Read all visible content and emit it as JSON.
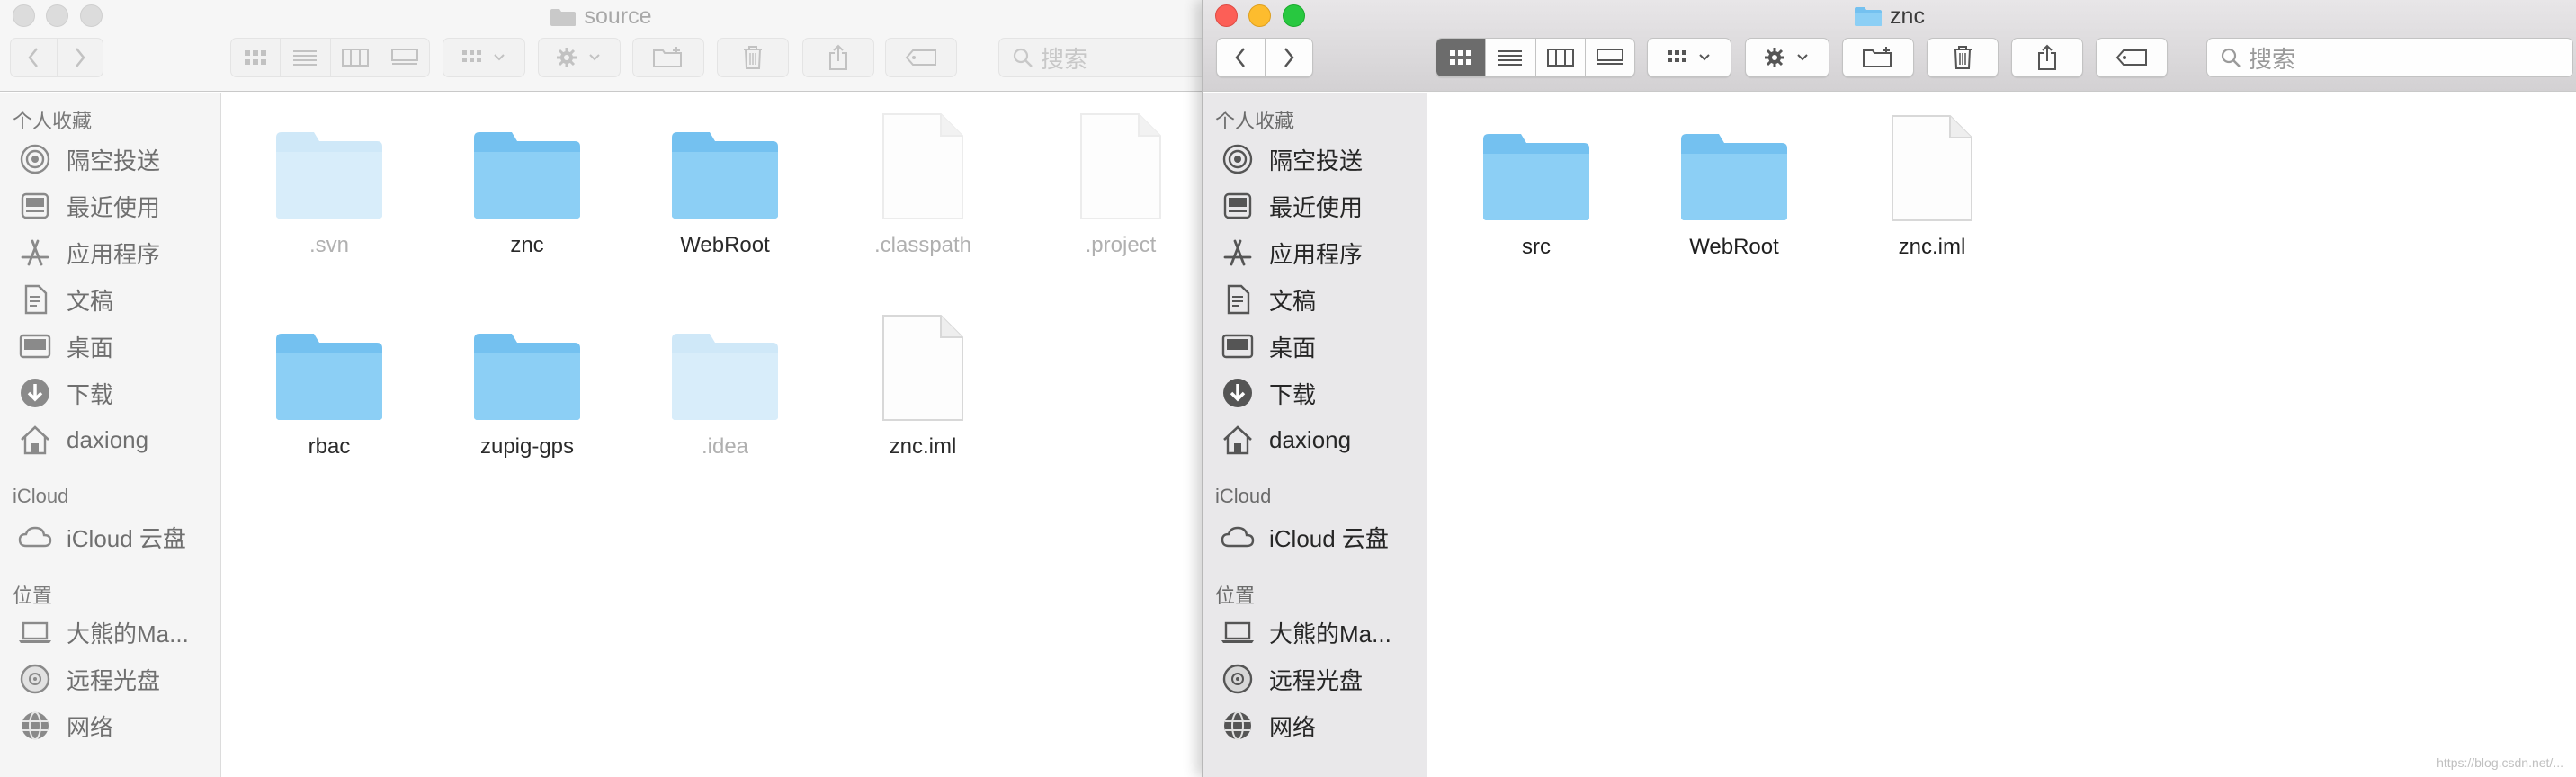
{
  "left_window": {
    "title": "source",
    "search_placeholder": "搜索",
    "sidebar": {
      "favorites_header": "个人收藏",
      "favorites": [
        {
          "label": "隔空投送",
          "icon": "airdrop-icon"
        },
        {
          "label": "最近使用",
          "icon": "recents-icon"
        },
        {
          "label": "应用程序",
          "icon": "applications-icon"
        },
        {
          "label": "文稿",
          "icon": "documents-icon"
        },
        {
          "label": "桌面",
          "icon": "desktop-icon"
        },
        {
          "label": "下载",
          "icon": "downloads-icon"
        },
        {
          "label": "daxiong",
          "icon": "home-icon"
        }
      ],
      "icloud_header": "iCloud",
      "icloud": [
        {
          "label": "iCloud 云盘",
          "icon": "cloud-icon"
        }
      ],
      "locations_header": "位置",
      "locations": [
        {
          "label": "大熊的Ma...",
          "icon": "laptop-icon"
        },
        {
          "label": "远程光盘",
          "icon": "disc-icon"
        },
        {
          "label": "网络",
          "icon": "network-icon"
        }
      ]
    },
    "files": [
      {
        "name": ".svn",
        "kind": "folder",
        "dim": true
      },
      {
        "name": "znc",
        "kind": "folder",
        "dim": false
      },
      {
        "name": "WebRoot",
        "kind": "folder",
        "dim": false
      },
      {
        "name": ".classpath",
        "kind": "document",
        "dim": true
      },
      {
        "name": ".project",
        "kind": "document",
        "dim": true
      },
      {
        "name": "rbac",
        "kind": "folder",
        "dim": false
      },
      {
        "name": "zupig-gps",
        "kind": "folder",
        "dim": false
      },
      {
        "name": ".idea",
        "kind": "folder",
        "dim": true
      },
      {
        "name": "znc.iml",
        "kind": "document",
        "dim": false
      }
    ]
  },
  "right_window": {
    "title": "znc",
    "search_placeholder": "搜索",
    "sidebar": {
      "favorites_header": "个人收藏",
      "favorites": [
        {
          "label": "隔空投送",
          "icon": "airdrop-icon"
        },
        {
          "label": "最近使用",
          "icon": "recents-icon"
        },
        {
          "label": "应用程序",
          "icon": "applications-icon"
        },
        {
          "label": "文稿",
          "icon": "documents-icon"
        },
        {
          "label": "桌面",
          "icon": "desktop-icon"
        },
        {
          "label": "下载",
          "icon": "downloads-icon"
        },
        {
          "label": "daxiong",
          "icon": "home-icon"
        }
      ],
      "icloud_header": "iCloud",
      "icloud": [
        {
          "label": "iCloud 云盘",
          "icon": "cloud-icon"
        }
      ],
      "locations_header": "位置",
      "locations": [
        {
          "label": "大熊的Ma...",
          "icon": "laptop-icon"
        },
        {
          "label": "远程光盘",
          "icon": "disc-icon"
        },
        {
          "label": "网络",
          "icon": "network-icon"
        }
      ]
    },
    "files": [
      {
        "name": "src",
        "kind": "folder",
        "dim": false
      },
      {
        "name": "WebRoot",
        "kind": "folder",
        "dim": false
      },
      {
        "name": "znc.iml",
        "kind": "document",
        "dim": false
      }
    ]
  },
  "watermark": "https://blog.csdn.net/...",
  "colors": {
    "folder": "#8ccff5",
    "folder_dim": "#cfe8f8",
    "close": "#fc5f57",
    "minimize": "#fdbc2e",
    "zoom": "#28c840"
  }
}
